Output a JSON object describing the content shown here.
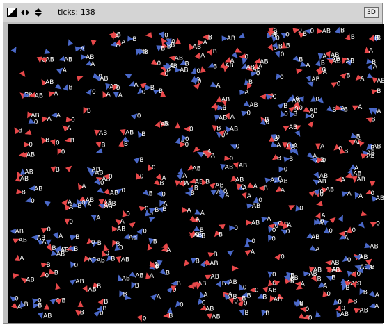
{
  "toolbar": {
    "ticks_label": "ticks:",
    "ticks_value": "138",
    "view_3d_label": "3D"
  },
  "colors": {
    "agent_red": "#e8484a",
    "agent_blue": "#4a68c8",
    "background": "#000000"
  },
  "view": {
    "label_options": [
      "A",
      "B",
      "AB",
      "0"
    ]
  }
}
